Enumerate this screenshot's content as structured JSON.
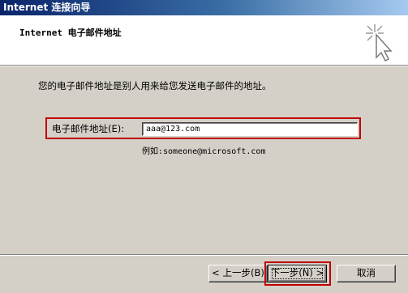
{
  "window": {
    "title": "Internet 连接向导"
  },
  "header": {
    "title": "Internet 电子邮件地址"
  },
  "main": {
    "intro": "您的电子邮件地址是别人用来给您发送电子邮件的地址。",
    "email_label": "电子邮件地址(E):",
    "email_value": "aaa@123.com",
    "example": "例如:someone@microsoft.com"
  },
  "buttons": {
    "back": "< 上一步(B)",
    "next": "下一步(N) >",
    "cancel": "取消"
  },
  "colors": {
    "highlight": "#c00000",
    "window_bg": "#d4d0c8"
  }
}
